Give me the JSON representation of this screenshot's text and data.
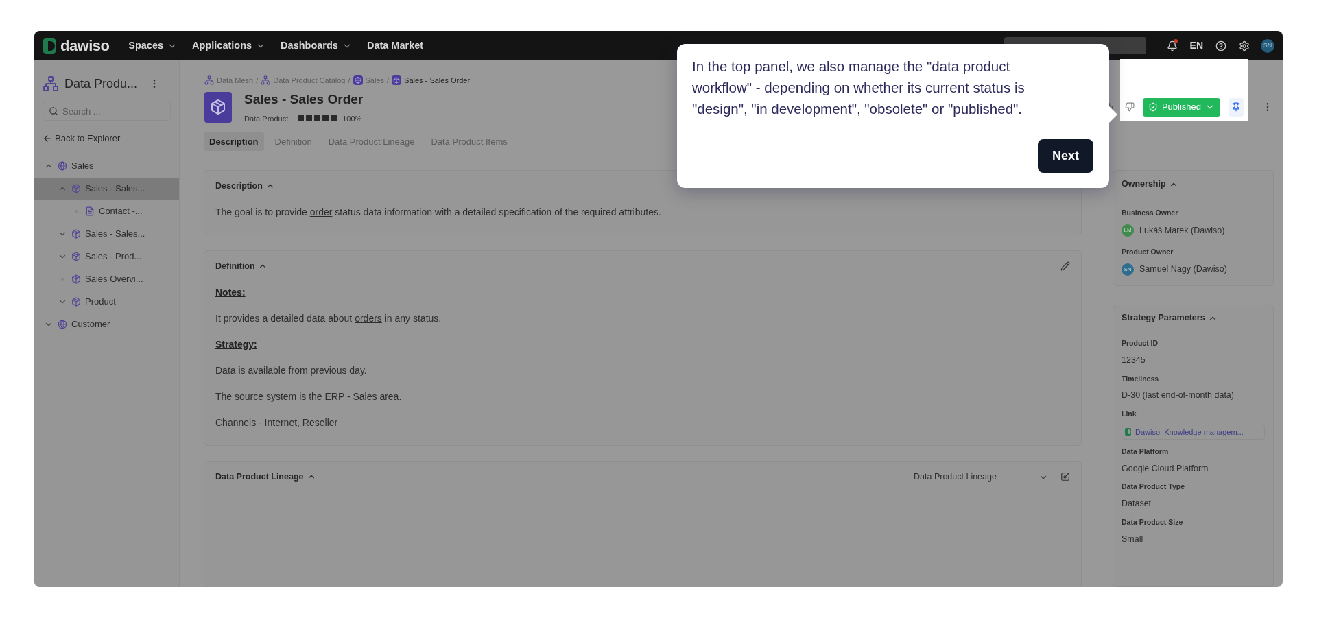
{
  "top_bar": {
    "logo": "dawiso",
    "nav": [
      {
        "label": "Spaces",
        "dropdown": true
      },
      {
        "label": "Applications",
        "dropdown": true
      },
      {
        "label": "Dashboards",
        "dropdown": true
      },
      {
        "label": "Data Market",
        "dropdown": false
      }
    ],
    "notifications": {
      "unread": true
    },
    "language": "EN",
    "avatar": "SN"
  },
  "sidebar": {
    "title": "Data Produ...",
    "search": {
      "placeholder": "Search ..."
    },
    "back_link": "Back to Explorer",
    "tree": [
      {
        "label": "Sales",
        "kind": "domain",
        "expanded": true,
        "selected": false,
        "children": [
          {
            "label": "Sales - Sales...",
            "kind": "product",
            "expanded": true,
            "selected": true,
            "children": [
              {
                "label": "Contact -...",
                "kind": "item",
                "selected": false
              }
            ]
          },
          {
            "label": "Sales - Sales...",
            "kind": "product",
            "expanded": false,
            "selected": false
          },
          {
            "label": "Sales - Prod...",
            "kind": "product",
            "expanded": false,
            "selected": false
          },
          {
            "label": "Sales Overvi...",
            "kind": "product",
            "selected": false
          },
          {
            "label": "Product",
            "kind": "product",
            "expanded": false,
            "selected": false
          }
        ]
      },
      {
        "label": "Customer",
        "kind": "domain",
        "expanded": false,
        "selected": false
      }
    ]
  },
  "breadcrumb": {
    "separator": "/",
    "items": [
      {
        "label": "Data Mesh",
        "kind": "mesh",
        "current": false
      },
      {
        "label": "Data Product Catalog",
        "kind": "mesh",
        "current": false
      },
      {
        "label": "Sales",
        "kind": "domain",
        "current": false
      },
      {
        "label": "Sales - Sales Order",
        "kind": "product",
        "current": true
      }
    ]
  },
  "header": {
    "title": "Sales - Sales Order",
    "type": "Data Product",
    "quality": {
      "level": 1,
      "reading": "100%"
    },
    "status": {
      "label": "Published",
      "kind": "published"
    }
  },
  "tabs": [
    {
      "label": "Description",
      "selected": true
    },
    {
      "label": "Definition",
      "selected": false
    },
    {
      "label": "Data Product Lineage",
      "selected": false
    },
    {
      "label": "Data Product Items",
      "selected": false
    }
  ],
  "sections": [
    {
      "title": "Description",
      "expanded": true,
      "editable": false,
      "blocks": [
        {
          "kind": "paragraph",
          "parts": [
            {
              "text": "The goal is to provide ",
              "kind": "text"
            },
            {
              "text": "order",
              "kind": "link"
            },
            {
              "text": " status data information with a detailed specification of the required attributes.",
              "kind": "text"
            }
          ]
        }
      ]
    },
    {
      "title": "Definition",
      "expanded": true,
      "editable": true,
      "blocks": [
        {
          "kind": "heading",
          "parts": [
            {
              "text": "Notes:",
              "kind": "text"
            }
          ]
        },
        {
          "kind": "paragraph",
          "parts": [
            {
              "text": "It provides a detailed data about ",
              "kind": "text"
            },
            {
              "text": "orders",
              "kind": "link"
            },
            {
              "text": " in any status.",
              "kind": "text"
            }
          ]
        },
        {
          "kind": "heading",
          "parts": [
            {
              "text": "Strategy:",
              "kind": "text"
            }
          ]
        },
        {
          "kind": "paragraph",
          "parts": [
            {
              "text": "Data is available from previous day.",
              "kind": "text"
            }
          ]
        },
        {
          "kind": "paragraph",
          "parts": [
            {
              "text": "The source system is the ERP - Sales area.",
              "kind": "text"
            }
          ]
        },
        {
          "kind": "paragraph",
          "parts": [
            {
              "text": "Channels - Internet, Reseller",
              "kind": "text"
            }
          ]
        }
      ]
    },
    {
      "title": "Data Product Lineage",
      "expanded": true,
      "editable": false,
      "view_select": "Data Product Lineage"
    }
  ],
  "ownership": {
    "title": "Ownership",
    "expanded": true,
    "owners": [
      {
        "role": "Business Owner",
        "initials": "LM",
        "name": "Lukáš Marek (Dawiso)",
        "color": "#3f8a4c"
      },
      {
        "role": "Product Owner",
        "initials": "SN",
        "name": "Samuel Nagy (Dawiso)",
        "color": "#2f6d8e"
      }
    ]
  },
  "strategy": {
    "title": "Strategy Parameters",
    "expanded": true,
    "fields": [
      {
        "label": "Product ID",
        "value": "12345",
        "kind": "text"
      },
      {
        "label": "Timeliness",
        "value": "D-30 (last end-of-month data)",
        "kind": "text"
      },
      {
        "label": "Link",
        "value": "Dawiso: Knowledge managem...",
        "kind": "link"
      },
      {
        "label": "Data Platform",
        "value": "Google Cloud Platform",
        "kind": "text"
      },
      {
        "label": "Data Product Type",
        "value": "Dataset",
        "kind": "text"
      },
      {
        "label": "Data Product Size",
        "value": "Small",
        "kind": "text"
      }
    ]
  },
  "tour_tooltip": {
    "text": "In the top panel, we also manage the \"data product workflow\" - depending on whether its current status is \"design\", \"in development\", \"obsolete\" or \"published\".",
    "button": "Next"
  }
}
